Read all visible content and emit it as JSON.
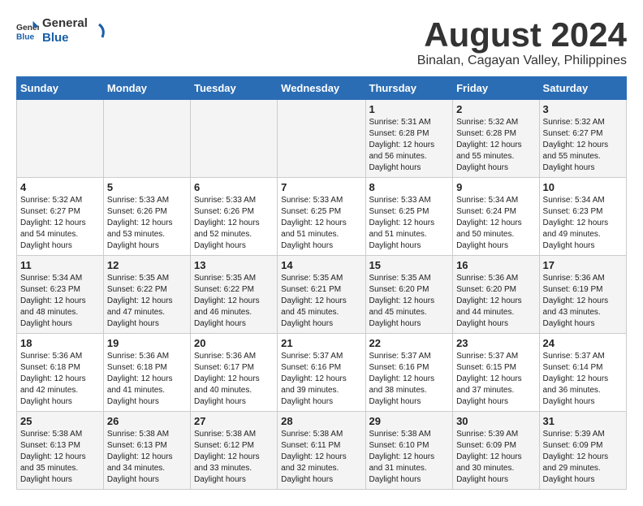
{
  "header": {
    "logo_line1": "General",
    "logo_line2": "Blue",
    "main_title": "August 2024",
    "subtitle": "Binalan, Cagayan Valley, Philippines"
  },
  "weekdays": [
    "Sunday",
    "Monday",
    "Tuesday",
    "Wednesday",
    "Thursday",
    "Friday",
    "Saturday"
  ],
  "weeks": [
    [
      {
        "day": "",
        "sunrise": "",
        "sunset": "",
        "daylight": ""
      },
      {
        "day": "",
        "sunrise": "",
        "sunset": "",
        "daylight": ""
      },
      {
        "day": "",
        "sunrise": "",
        "sunset": "",
        "daylight": ""
      },
      {
        "day": "",
        "sunrise": "",
        "sunset": "",
        "daylight": ""
      },
      {
        "day": "1",
        "sunrise": "5:31 AM",
        "sunset": "6:28 PM",
        "daylight": "12 hours and 56 minutes."
      },
      {
        "day": "2",
        "sunrise": "5:32 AM",
        "sunset": "6:28 PM",
        "daylight": "12 hours and 55 minutes."
      },
      {
        "day": "3",
        "sunrise": "5:32 AM",
        "sunset": "6:27 PM",
        "daylight": "12 hours and 55 minutes."
      }
    ],
    [
      {
        "day": "4",
        "sunrise": "5:32 AM",
        "sunset": "6:27 PM",
        "daylight": "12 hours and 54 minutes."
      },
      {
        "day": "5",
        "sunrise": "5:33 AM",
        "sunset": "6:26 PM",
        "daylight": "12 hours and 53 minutes."
      },
      {
        "day": "6",
        "sunrise": "5:33 AM",
        "sunset": "6:26 PM",
        "daylight": "12 hours and 52 minutes."
      },
      {
        "day": "7",
        "sunrise": "5:33 AM",
        "sunset": "6:25 PM",
        "daylight": "12 hours and 51 minutes."
      },
      {
        "day": "8",
        "sunrise": "5:33 AM",
        "sunset": "6:25 PM",
        "daylight": "12 hours and 51 minutes."
      },
      {
        "day": "9",
        "sunrise": "5:34 AM",
        "sunset": "6:24 PM",
        "daylight": "12 hours and 50 minutes."
      },
      {
        "day": "10",
        "sunrise": "5:34 AM",
        "sunset": "6:23 PM",
        "daylight": "12 hours and 49 minutes."
      }
    ],
    [
      {
        "day": "11",
        "sunrise": "5:34 AM",
        "sunset": "6:23 PM",
        "daylight": "12 hours and 48 minutes."
      },
      {
        "day": "12",
        "sunrise": "5:35 AM",
        "sunset": "6:22 PM",
        "daylight": "12 hours and 47 minutes."
      },
      {
        "day": "13",
        "sunrise": "5:35 AM",
        "sunset": "6:22 PM",
        "daylight": "12 hours and 46 minutes."
      },
      {
        "day": "14",
        "sunrise": "5:35 AM",
        "sunset": "6:21 PM",
        "daylight": "12 hours and 45 minutes."
      },
      {
        "day": "15",
        "sunrise": "5:35 AM",
        "sunset": "6:20 PM",
        "daylight": "12 hours and 45 minutes."
      },
      {
        "day": "16",
        "sunrise": "5:36 AM",
        "sunset": "6:20 PM",
        "daylight": "12 hours and 44 minutes."
      },
      {
        "day": "17",
        "sunrise": "5:36 AM",
        "sunset": "6:19 PM",
        "daylight": "12 hours and 43 minutes."
      }
    ],
    [
      {
        "day": "18",
        "sunrise": "5:36 AM",
        "sunset": "6:18 PM",
        "daylight": "12 hours and 42 minutes."
      },
      {
        "day": "19",
        "sunrise": "5:36 AM",
        "sunset": "6:18 PM",
        "daylight": "12 hours and 41 minutes."
      },
      {
        "day": "20",
        "sunrise": "5:36 AM",
        "sunset": "6:17 PM",
        "daylight": "12 hours and 40 minutes."
      },
      {
        "day": "21",
        "sunrise": "5:37 AM",
        "sunset": "6:16 PM",
        "daylight": "12 hours and 39 minutes."
      },
      {
        "day": "22",
        "sunrise": "5:37 AM",
        "sunset": "6:16 PM",
        "daylight": "12 hours and 38 minutes."
      },
      {
        "day": "23",
        "sunrise": "5:37 AM",
        "sunset": "6:15 PM",
        "daylight": "12 hours and 37 minutes."
      },
      {
        "day": "24",
        "sunrise": "5:37 AM",
        "sunset": "6:14 PM",
        "daylight": "12 hours and 36 minutes."
      }
    ],
    [
      {
        "day": "25",
        "sunrise": "5:38 AM",
        "sunset": "6:13 PM",
        "daylight": "12 hours and 35 minutes."
      },
      {
        "day": "26",
        "sunrise": "5:38 AM",
        "sunset": "6:13 PM",
        "daylight": "12 hours and 34 minutes."
      },
      {
        "day": "27",
        "sunrise": "5:38 AM",
        "sunset": "6:12 PM",
        "daylight": "12 hours and 33 minutes."
      },
      {
        "day": "28",
        "sunrise": "5:38 AM",
        "sunset": "6:11 PM",
        "daylight": "12 hours and 32 minutes."
      },
      {
        "day": "29",
        "sunrise": "5:38 AM",
        "sunset": "6:10 PM",
        "daylight": "12 hours and 31 minutes."
      },
      {
        "day": "30",
        "sunrise": "5:39 AM",
        "sunset": "6:09 PM",
        "daylight": "12 hours and 30 minutes."
      },
      {
        "day": "31",
        "sunrise": "5:39 AM",
        "sunset": "6:09 PM",
        "daylight": "12 hours and 29 minutes."
      }
    ]
  ]
}
